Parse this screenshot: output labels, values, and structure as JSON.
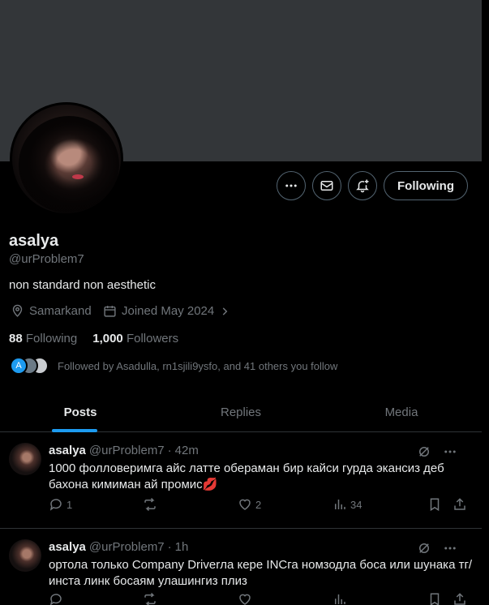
{
  "profile": {
    "name": "asalya",
    "handle": "@urProblem7",
    "bio": "non standard non aesthetic",
    "location": "Samarkand",
    "joined": "Joined May 2024",
    "following_count": "88",
    "following_label": "Following",
    "followers_count": "1,000",
    "followers_label": "Followers",
    "followed_by": "Followed by Asadulla, rn1sjili9ysfo, and 41 others you follow",
    "followed_by_avatar_letter": "A"
  },
  "actions": {
    "follow_label": "Following"
  },
  "tabs": [
    {
      "label": "Posts",
      "active": true
    },
    {
      "label": "Replies",
      "active": false
    },
    {
      "label": "Media",
      "active": false
    }
  ],
  "posts": [
    {
      "name": "asalya",
      "handle": "@urProblem7",
      "time": "42m",
      "text": "1000 фолловеримга айс латте обераман бир кайси гурда экансиз деб бахона кимиман ай промис💋",
      "replies": "1",
      "retweets": "",
      "likes": "2",
      "views": "34"
    },
    {
      "name": "asalya",
      "handle": "@urProblem7",
      "time": "1h",
      "text": "ортола только Company Driverла кере INCга номзодла боса или шунака тг/инста линк босаям улашингиз плиз",
      "replies": "",
      "retweets": "",
      "likes": "",
      "views": ""
    }
  ],
  "colors": {
    "accent": "#1d9bf0",
    "banner": "#333639",
    "muted": "#71767b",
    "border": "#2f3336"
  }
}
